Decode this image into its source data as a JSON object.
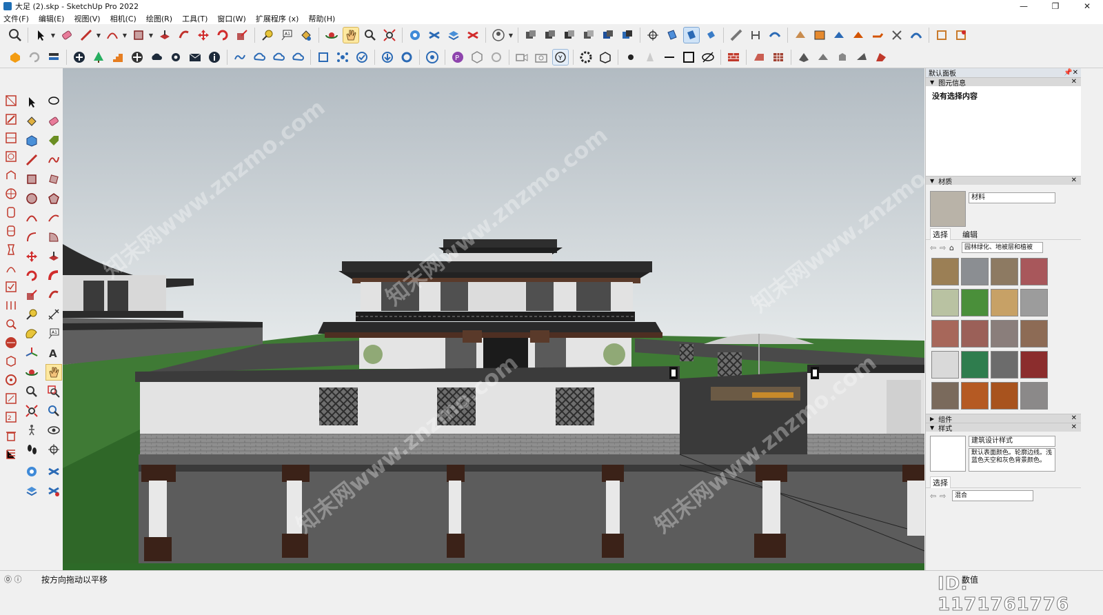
{
  "window": {
    "title": "大足 (2).skp - SketchUp Pro 2022",
    "minimize": "—",
    "restore": "❐",
    "close": "✕"
  },
  "menu": [
    "文件(F)",
    "编辑(E)",
    "视图(V)",
    "相机(C)",
    "绘图(R)",
    "工具(T)",
    "窗口(W)",
    "扩展程序 (x)",
    "帮助(H)"
  ],
  "tray": {
    "title": "默认面板",
    "entity_info": {
      "header": "图元信息",
      "body": "没有选择内容"
    },
    "materials": {
      "header": "材质",
      "name": "材料",
      "tab_select": "选择",
      "tab_edit": "编辑",
      "library": "园林绿化、地被层和植被",
      "swatch_colors": [
        "#9b7f55",
        "#8b8e92",
        "#8d7a62",
        "#a8575b",
        "#b9c2a2",
        "#4a8f3a",
        "#c7a166",
        "#9c9c9c",
        "#a7675a",
        "#9b6058",
        "#8a7e7b",
        "#8d6b55",
        "#d9d9d9",
        "#2f7d4e",
        "#6c6c6c",
        "#8b2d2d",
        "#7a6a5c",
        "#b55a23",
        "#a8531e",
        "#8b8989"
      ]
    },
    "components": {
      "header": "组件"
    },
    "styles": {
      "header": "样式",
      "name": "建筑设计样式",
      "description": "默认表面颜色。轮廓边线。浅蓝色天空和灰色背景颜色。",
      "tab_select": "选择",
      "library": "混合"
    }
  },
  "statusbar": {
    "hint": "按方向拖动以平移",
    "measurement_label": "数值",
    "watermark_id": "ID: 1171761776"
  },
  "watermark_text": "知末网www.znzmo.com"
}
